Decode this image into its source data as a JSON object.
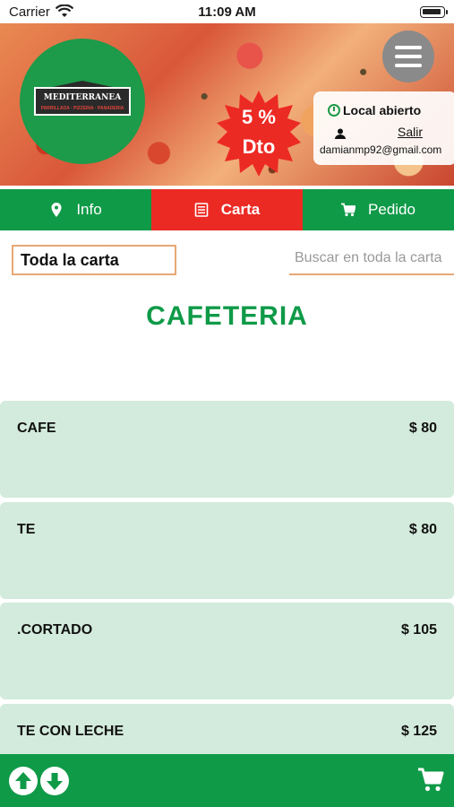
{
  "status_bar": {
    "carrier": "Carrier",
    "time": "11:09 AM"
  },
  "header": {
    "logo": {
      "name": "MEDITERRANEA",
      "subtitle": "PARRILLADA · PIZZERIA · PANADERIA"
    },
    "discount": {
      "percent": "5 %",
      "label": "Dto"
    },
    "store_status": "Local abierto",
    "logout": "Salir",
    "email": "damianmp92@gmail.com",
    "menu_icon": "hamburger-menu-icon"
  },
  "tabs": [
    {
      "label": "Info",
      "icon": "location-pin-icon",
      "active": false
    },
    {
      "label": "Carta",
      "icon": "menu-list-icon",
      "active": true
    },
    {
      "label": "Pedido",
      "icon": "cart-icon",
      "active": false
    }
  ],
  "filter": {
    "category": "Toda la carta",
    "search_placeholder": "Buscar en toda la carta"
  },
  "section_title": "CAFETERIA",
  "products": [
    {
      "name": "CAFE",
      "price": "$ 80"
    },
    {
      "name": "TE",
      "price": "$ 80"
    },
    {
      "name": ".CORTADO",
      "price": "$ 105"
    },
    {
      "name": "TE CON LECHE",
      "price": "$ 125"
    }
  ],
  "bottom_bar": {
    "scroll_up_icon": "arrow-up-icon",
    "scroll_down_icon": "arrow-down-icon",
    "cart_icon": "cart-icon"
  },
  "colors": {
    "brand_green": "#0f9a48",
    "active_tab_red": "#ec2a24",
    "product_bg": "#d3ebdc",
    "accent_orange": "#e7a874"
  }
}
